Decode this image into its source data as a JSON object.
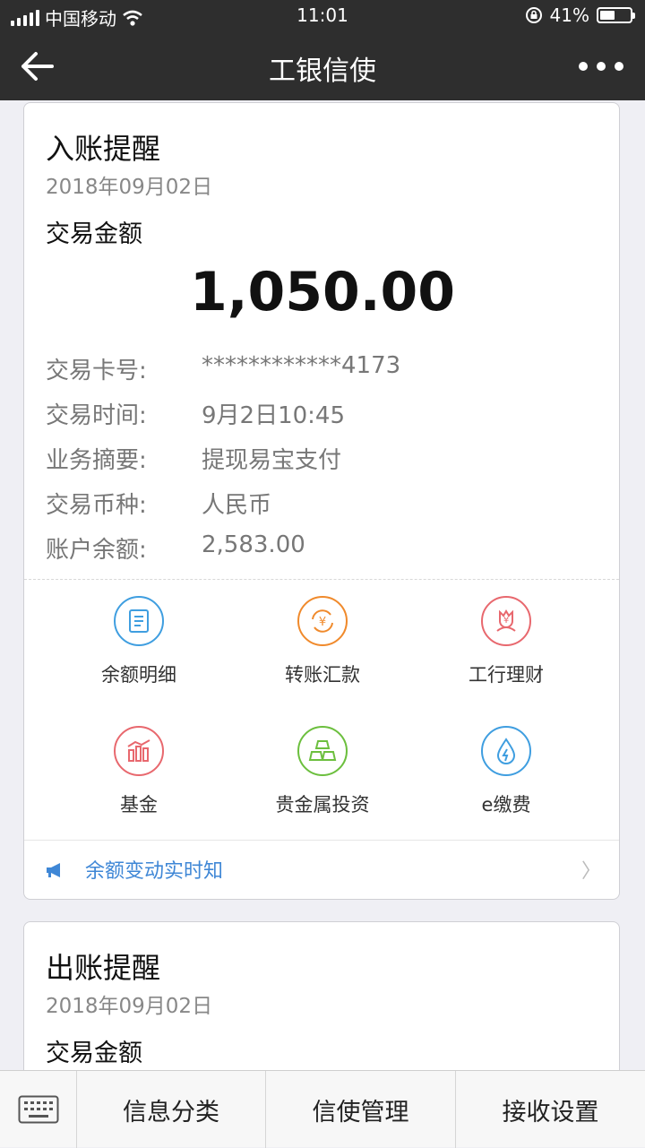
{
  "status_bar": {
    "carrier": "中国移动",
    "time": "11:01",
    "battery": "41%"
  },
  "nav": {
    "title": "工银信使"
  },
  "card1": {
    "title": "入账提醒",
    "date": "2018年09月02日",
    "amount_label": "交易金额",
    "amount": "1,050.00",
    "details": [
      {
        "key": "交易卡号:",
        "value": "************4173"
      },
      {
        "key": "交易时间:",
        "value": "9月2日10:45"
      },
      {
        "key": "业务摘要:",
        "value": "提现易宝支付"
      },
      {
        "key": "交易币种:",
        "value": "人民币"
      },
      {
        "key": "账户余额:",
        "value": "2,583.00"
      }
    ],
    "services": [
      {
        "label": "余额明细",
        "icon": "document-icon",
        "color": "#3f9ee0"
      },
      {
        "label": "转账汇款",
        "icon": "yuan-transfer-icon",
        "color": "#f08a2c"
      },
      {
        "label": "工行理财",
        "icon": "finance-flower-icon",
        "color": "#e8686e"
      },
      {
        "label": "基金",
        "icon": "fund-chart-icon",
        "color": "#e8686e"
      },
      {
        "label": "贵金属投资",
        "icon": "gold-bars-icon",
        "color": "#6cbf3e"
      },
      {
        "label": "e缴费",
        "icon": "water-drop-icon",
        "color": "#3f9ee0"
      }
    ],
    "footer_text": "余额变动实时知",
    "footer_chevron": "〉"
  },
  "card2": {
    "title": "出账提醒",
    "date": "2018年09月02日",
    "amount_label": "交易金额"
  },
  "bottom_bar": {
    "tabs": [
      "信息分类",
      "信使管理",
      "接收设置"
    ]
  },
  "colors": {
    "nav_bg": "#2e2e2e",
    "link_blue": "#3f87d6",
    "page_bg": "#efeff4"
  }
}
